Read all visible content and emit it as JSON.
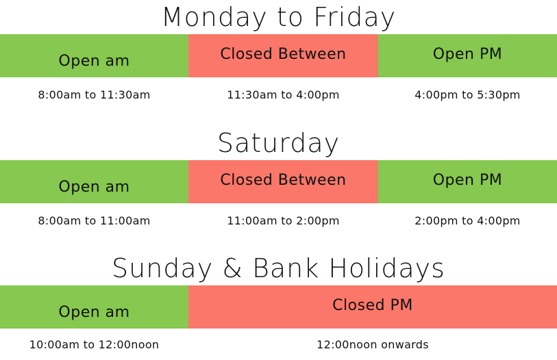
{
  "weekdays": {
    "title": "Monday to Friday",
    "open_am_label": "Open am",
    "closed_label": "Closed Between",
    "open_pm_label": "Open PM",
    "open_am_time": "8:00am to 11:30am",
    "closed_time": "11:30am to 4:00pm",
    "open_pm_time": "4:00pm to 5:30pm"
  },
  "saturday": {
    "title": "Saturday",
    "open_am_label": "Open am",
    "closed_label": "Closed Between",
    "open_pm_label": "Open PM",
    "open_am_time": "8:00am to 11:00am",
    "closed_time": "11:00am to 2:00pm",
    "open_pm_time": "2:00pm to 4:00pm"
  },
  "sunday": {
    "title": "Sunday & Bank Holidays",
    "open_am_label": "Open am",
    "closed_label": "Closed PM",
    "open_am_time": "10:00am to 12:00noon",
    "closed_time": "12:00noon onwards"
  },
  "colors": {
    "open": "#86c850",
    "closed": "#fa776a"
  }
}
